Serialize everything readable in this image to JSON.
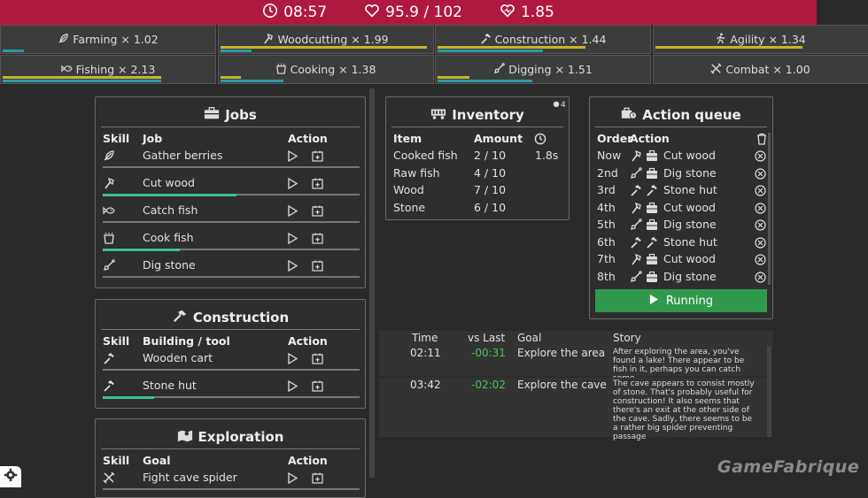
{
  "topbar": {
    "time": "08:57",
    "health": "95.9 / 102",
    "regen": "1.85",
    "color": "#b0193f"
  },
  "skills": [
    {
      "label": "Farming × 1.02",
      "icon": "feather-icon",
      "yellow": 0,
      "teal": 0.1
    },
    {
      "label": "Woodcutting × 1.99",
      "icon": "axe-icon",
      "yellow": 0.98,
      "teal": 0.15
    },
    {
      "label": "Construction × 1.44",
      "icon": "hammer-icon",
      "yellow": 0.7,
      "teal": 0.5
    },
    {
      "label": "Agility × 1.34",
      "icon": "running-icon",
      "yellow": 0.7,
      "teal": 0
    },
    {
      "label": "Fishing × 2.13",
      "icon": "fish-icon",
      "yellow": 0.75,
      "teal": 0.75
    },
    {
      "label": "Cooking × 1.38",
      "icon": "pot-icon",
      "yellow": 0.1,
      "teal": 0.3
    },
    {
      "label": "Digging × 1.51",
      "icon": "shovel-icon",
      "yellow": 0.15,
      "teal": 0.45
    },
    {
      "label": "Combat × 1.00",
      "icon": "swords-icon",
      "yellow": 0,
      "teal": 0
    }
  ],
  "jobs": {
    "title": "Jobs",
    "headers": {
      "skill": "Skill",
      "job": "Job",
      "action": "Action"
    },
    "rows": [
      {
        "icon": "feather-icon",
        "label": "Gather berries",
        "progress": 0
      },
      {
        "icon": "axe-icon",
        "label": "Cut wood",
        "progress": 0.52
      },
      {
        "icon": "fish-icon",
        "label": "Catch fish",
        "progress": 0
      },
      {
        "icon": "pot-icon",
        "label": "Cook fish",
        "progress": 0.3
      },
      {
        "icon": "shovel-icon",
        "label": "Dig stone",
        "progress": 0
      }
    ]
  },
  "construction": {
    "title": "Construction",
    "headers": {
      "skill": "Skill",
      "job": "Building / tool",
      "action": "Action"
    },
    "rows": [
      {
        "icon": "hammer-icon",
        "label": "Wooden cart",
        "progress": 0
      },
      {
        "icon": "hammer-icon",
        "label": "Stone hut",
        "progress": 0.2
      }
    ]
  },
  "exploration": {
    "title": "Exploration",
    "headers": {
      "skill": "Skill",
      "job": "Goal",
      "action": "Action"
    },
    "rows": [
      {
        "icon": "swords-icon",
        "label": "Fight cave spider",
        "progress": 0
      }
    ]
  },
  "inventory": {
    "title": "Inventory",
    "badge": "4",
    "headers": {
      "item": "Item",
      "amount": "Amount"
    },
    "rows": [
      {
        "item": "Cooked fish",
        "amount": "2 / 10",
        "time": "1.8s"
      },
      {
        "item": "Raw fish",
        "amount": "4 / 10",
        "time": ""
      },
      {
        "item": "Wood",
        "amount": "7 / 10",
        "time": ""
      },
      {
        "item": "Stone",
        "amount": "6 / 10",
        "time": ""
      }
    ]
  },
  "queue": {
    "title": "Action queue",
    "headers": {
      "order": "Order",
      "action": "Action"
    },
    "rows": [
      {
        "order": "Now",
        "icon": "axe-icon",
        "kind": "job",
        "label": "Cut wood"
      },
      {
        "order": "2nd",
        "icon": "shovel-icon",
        "kind": "job",
        "label": "Dig stone"
      },
      {
        "order": "3rd",
        "icon": "hammer-icon",
        "kind": "build",
        "label": "Stone hut"
      },
      {
        "order": "4th",
        "icon": "axe-icon",
        "kind": "job",
        "label": "Cut wood"
      },
      {
        "order": "5th",
        "icon": "shovel-icon",
        "kind": "job",
        "label": "Dig stone"
      },
      {
        "order": "6th",
        "icon": "hammer-icon",
        "kind": "build",
        "label": "Stone hut"
      },
      {
        "order": "7th",
        "icon": "axe-icon",
        "kind": "job",
        "label": "Cut wood"
      },
      {
        "order": "8th",
        "icon": "shovel-icon",
        "kind": "job",
        "label": "Dig stone"
      }
    ],
    "run_label": "Running"
  },
  "story": {
    "headers": {
      "time": "Time",
      "vs": "vs Last",
      "goal": "Goal",
      "story": "Story"
    },
    "rows": [
      {
        "time": "02:11",
        "vs": "-00:31",
        "goal": "Explore the area",
        "story": "After exploring the area, you've found a lake! There appear to be fish in it, perhaps you can catch some"
      },
      {
        "time": "03:42",
        "vs": "-02:02",
        "goal": "Explore the cave",
        "story": "The cave appears to consist mostly of stone. That's probably useful for construction! It also seems that there's an exit at the other side of the cave. Sadly, there seems to be a rather big spider preventing passage"
      }
    ]
  },
  "watermark": "GameFabrique"
}
